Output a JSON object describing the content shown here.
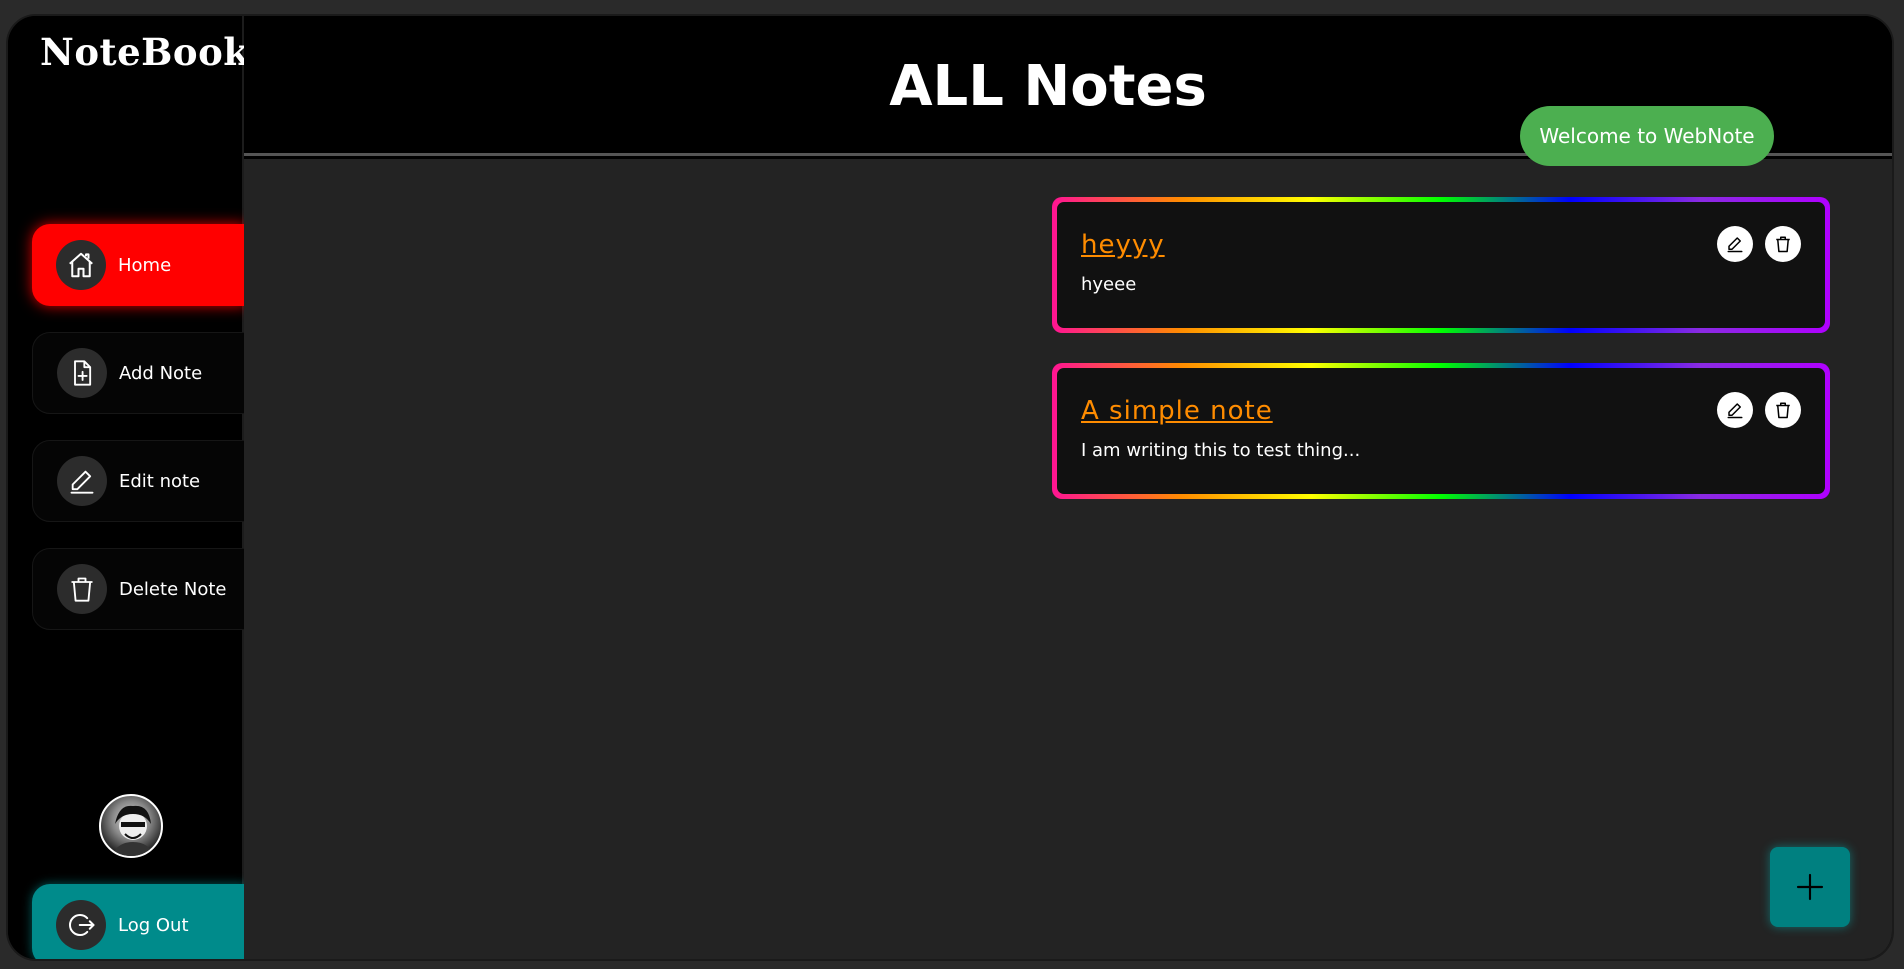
{
  "app": {
    "brand": "NoteBook"
  },
  "header": {
    "title": "ALL Notes"
  },
  "toast": {
    "text": "Welcome to WebNote"
  },
  "sidebar": {
    "items": [
      {
        "label": "Home",
        "icon": "home-icon"
      },
      {
        "label": "Add Note",
        "icon": "file-plus-icon"
      },
      {
        "label": "Edit note",
        "icon": "pencil-icon"
      },
      {
        "label": "Delete Note",
        "icon": "trash-icon"
      }
    ],
    "logout": {
      "label": "Log Out",
      "icon": "logout-icon"
    }
  },
  "notes": [
    {
      "title": "heyyy",
      "body": "hyeee"
    },
    {
      "title": "A simple note",
      "body": "I am writing this to test thing..."
    }
  ],
  "colors": {
    "active": "#ff0000",
    "logout": "#008b8b",
    "toast": "#4caf50",
    "note_title": "#ff8c00",
    "fab": "#008080"
  }
}
